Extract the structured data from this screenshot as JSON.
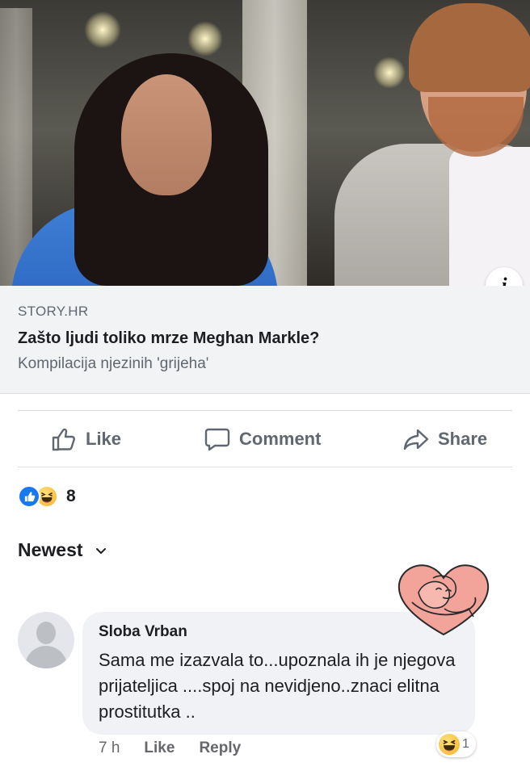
{
  "post": {
    "link": {
      "domain": "STORY.HR",
      "title": "Zašto ljudi toliko mrze Meghan Markle?",
      "description": "Kompilacija njezinih 'grijeha'"
    },
    "actions": {
      "like": "Like",
      "comment": "Comment",
      "share": "Share"
    },
    "reactions": {
      "types": [
        "like-icon",
        "haha-icon"
      ],
      "count": "8"
    }
  },
  "comments_section": {
    "sort_label": "Newest",
    "comments": [
      {
        "author": "Sloba Vrban",
        "text": "Sama me izazvala to...upoznala ih je njegova prijateljica ....spoj na nevidjeno..znaci elitna prostitutka ..",
        "time": "7 h",
        "like_label": "Like",
        "reply_label": "Reply",
        "reaction_count": "1"
      }
    ]
  },
  "colors": {
    "accent": "#1877f2",
    "action_gray": "#606770",
    "bubble_bg": "#f0f2f5",
    "link_box_bg": "#f2f3f5"
  }
}
